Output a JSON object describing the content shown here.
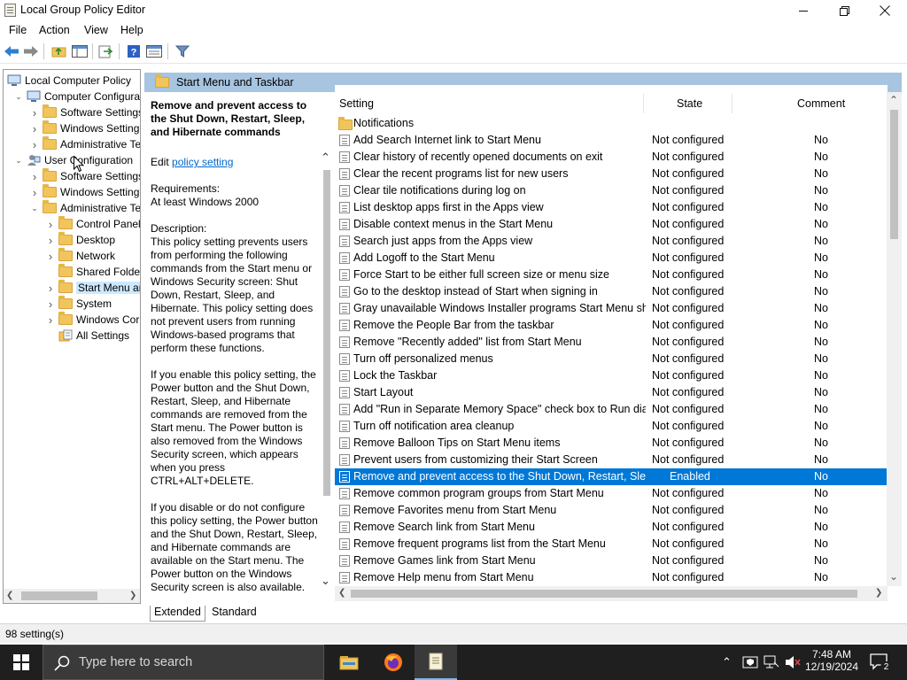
{
  "window": {
    "title": "Local Group Policy Editor"
  },
  "menu": [
    "File",
    "Action",
    "View",
    "Help"
  ],
  "tree": [
    {
      "label": "Local Computer Policy",
      "depth": 0,
      "expander": "",
      "type": "computer"
    },
    {
      "label": "Computer Configura",
      "depth": 1,
      "expander": "open",
      "type": "computer"
    },
    {
      "label": "Software Settings",
      "depth": 2,
      "expander": "closed",
      "type": "folder"
    },
    {
      "label": "Windows Setting",
      "depth": 2,
      "expander": "closed",
      "type": "folder"
    },
    {
      "label": "Administrative Te",
      "depth": 2,
      "expander": "closed",
      "type": "folder"
    },
    {
      "label": "User Configuration",
      "depth": 1,
      "expander": "open",
      "type": "user"
    },
    {
      "label": "Software Settings",
      "depth": 2,
      "expander": "closed",
      "type": "folder"
    },
    {
      "label": "Windows Setting",
      "depth": 2,
      "expander": "closed",
      "type": "folder"
    },
    {
      "label": "Administrative Te",
      "depth": 2,
      "expander": "open",
      "type": "folder"
    },
    {
      "label": "Control Panel",
      "depth": 3,
      "expander": "closed",
      "type": "folder"
    },
    {
      "label": "Desktop",
      "depth": 3,
      "expander": "closed",
      "type": "folder"
    },
    {
      "label": "Network",
      "depth": 3,
      "expander": "closed",
      "type": "folder"
    },
    {
      "label": "Shared Folder",
      "depth": 3,
      "expander": "",
      "type": "folder"
    },
    {
      "label": "Start Menu ar",
      "depth": 3,
      "expander": "closed",
      "type": "folder",
      "selected": true
    },
    {
      "label": "System",
      "depth": 3,
      "expander": "closed",
      "type": "folder"
    },
    {
      "label": "Windows Cor",
      "depth": 3,
      "expander": "closed",
      "type": "folder"
    },
    {
      "label": "All Settings",
      "depth": 3,
      "expander": "",
      "type": "allsettings"
    }
  ],
  "detail": {
    "header_title": "Start Menu and Taskbar"
  },
  "description": {
    "title": "Remove and prevent access to the Shut Down, Restart, Sleep, and Hibernate commands",
    "edit_prefix": "Edit ",
    "edit_link": "policy setting ",
    "requirements_label": "Requirements:",
    "requirements_value": "At least Windows 2000",
    "description_label": "Description:",
    "p1": "This policy setting prevents users from performing the following commands from the Start menu or Windows Security screen: Shut Down, Restart, Sleep, and Hibernate. This policy setting does not prevent users from running Windows-based programs that perform these functions.",
    "p2": "If you enable this policy setting, the Power button and the Shut Down, Restart, Sleep, and Hibernate commands are removed from the Start menu. The Power button is also removed from the Windows Security screen, which appears when you press CTRL+ALT+DELETE.",
    "p3": "If you disable or do not configure this policy setting, the Power button and the Shut Down, Restart, Sleep, and Hibernate commands are available on the Start menu. The Power button on the Windows Security screen is also available."
  },
  "columns": {
    "setting": "Setting",
    "state": "State",
    "comment": "Comment"
  },
  "settings": [
    {
      "name": "Notifications",
      "state": "",
      "comment": "",
      "folder": true
    },
    {
      "name": "Add Search Internet link to Start Menu",
      "state": "Not configured",
      "comment": "No"
    },
    {
      "name": "Clear history of recently opened documents on exit",
      "state": "Not configured",
      "comment": "No"
    },
    {
      "name": "Clear the recent programs list for new users",
      "state": "Not configured",
      "comment": "No"
    },
    {
      "name": "Clear tile notifications during log on",
      "state": "Not configured",
      "comment": "No"
    },
    {
      "name": "List desktop apps first in the Apps view",
      "state": "Not configured",
      "comment": "No"
    },
    {
      "name": "Disable context menus in the Start Menu",
      "state": "Not configured",
      "comment": "No"
    },
    {
      "name": "Search just apps from the Apps view",
      "state": "Not configured",
      "comment": "No"
    },
    {
      "name": "Add Logoff to the Start Menu",
      "state": "Not configured",
      "comment": "No"
    },
    {
      "name": "Force Start to be either full screen size or menu size",
      "state": "Not configured",
      "comment": "No"
    },
    {
      "name": "Go to the desktop instead of Start when signing in",
      "state": "Not configured",
      "comment": "No"
    },
    {
      "name": "Gray unavailable Windows Installer programs Start Menu sh...",
      "state": "Not configured",
      "comment": "No"
    },
    {
      "name": "Remove the People Bar from the taskbar",
      "state": "Not configured",
      "comment": "No"
    },
    {
      "name": "Remove \"Recently added\" list from Start Menu",
      "state": "Not configured",
      "comment": "No"
    },
    {
      "name": "Turn off personalized menus",
      "state": "Not configured",
      "comment": "No"
    },
    {
      "name": "Lock the Taskbar",
      "state": "Not configured",
      "comment": "No"
    },
    {
      "name": "Start Layout",
      "state": "Not configured",
      "comment": "No"
    },
    {
      "name": "Add \"Run in Separate Memory Space\" check box to Run dial...",
      "state": "Not configured",
      "comment": "No"
    },
    {
      "name": "Turn off notification area cleanup",
      "state": "Not configured",
      "comment": "No"
    },
    {
      "name": "Remove Balloon Tips on Start Menu items",
      "state": "Not configured",
      "comment": "No"
    },
    {
      "name": "Prevent users from customizing their Start Screen",
      "state": "Not configured",
      "comment": "No"
    },
    {
      "name": "Remove and prevent access to the Shut Down, Restart, Sleep...",
      "state": "Enabled",
      "comment": "No",
      "selected": true
    },
    {
      "name": "Remove common program groups from Start Menu",
      "state": "Not configured",
      "comment": "No"
    },
    {
      "name": "Remove Favorites menu from Start Menu",
      "state": "Not configured",
      "comment": "No"
    },
    {
      "name": "Remove Search link from Start Menu",
      "state": "Not configured",
      "comment": "No"
    },
    {
      "name": "Remove frequent programs list from the Start Menu",
      "state": "Not configured",
      "comment": "No"
    },
    {
      "name": "Remove Games link from Start Menu",
      "state": "Not configured",
      "comment": "No"
    },
    {
      "name": "Remove Help menu from Start Menu",
      "state": "Not configured",
      "comment": "No"
    }
  ],
  "tabs": {
    "extended": "Extended",
    "standard": "Standard"
  },
  "status": {
    "text": "98 setting(s)"
  },
  "taskbar": {
    "search_placeholder": "Type here to search",
    "time": "7:48 AM",
    "date": "12/19/2024",
    "notification_count": "2"
  },
  "colors": {
    "accent": "#0078d7",
    "header": "#a7c4e0",
    "taskbar": "#1f1f1f"
  }
}
